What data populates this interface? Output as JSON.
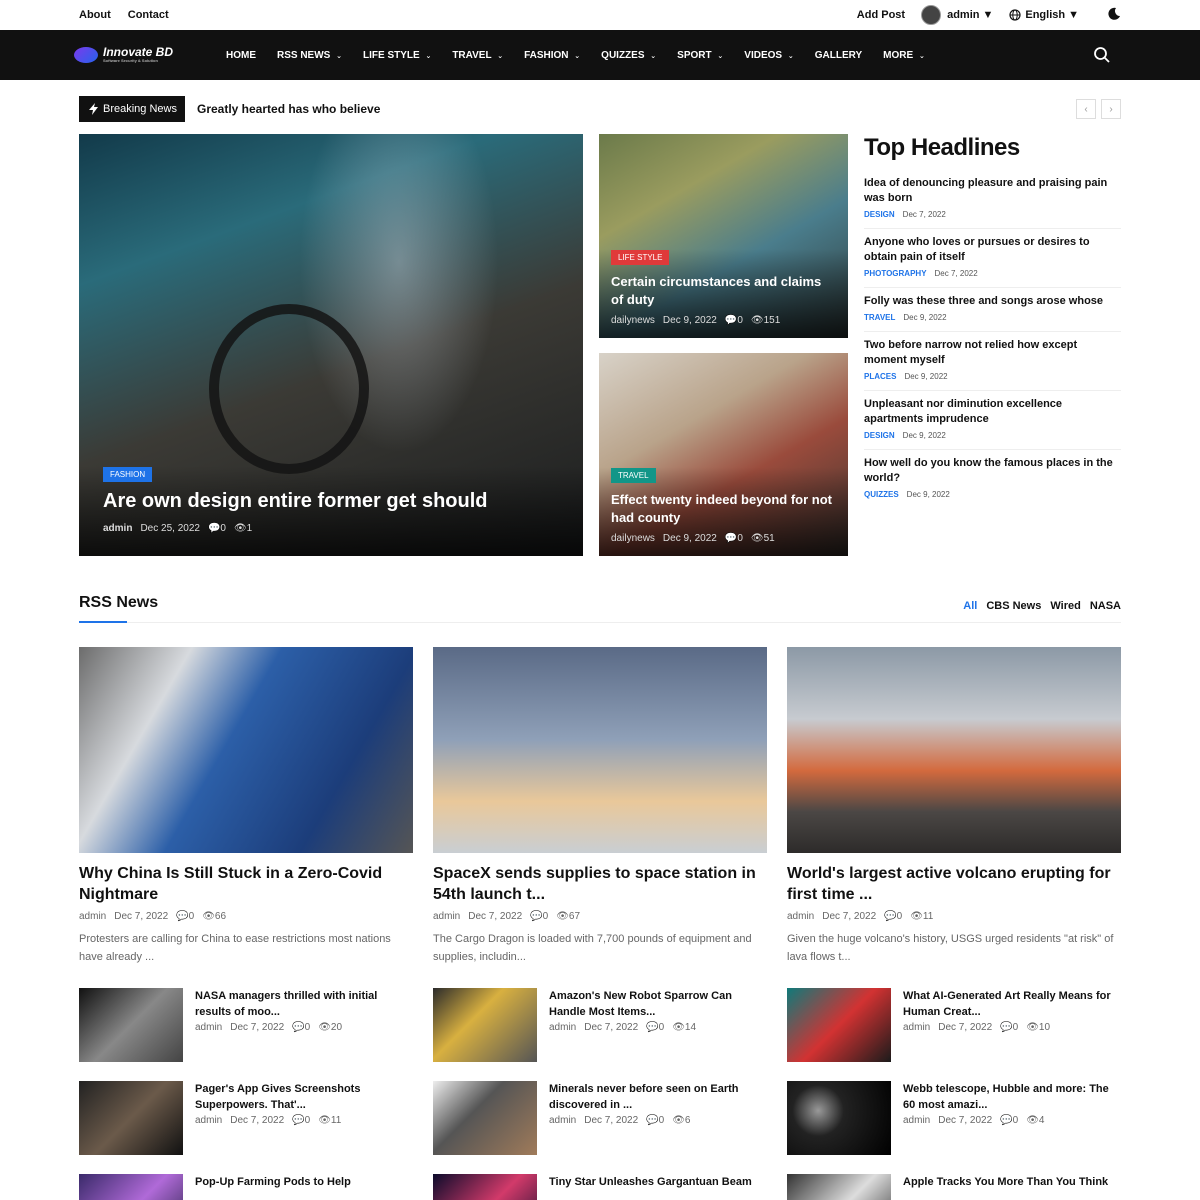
{
  "top": {
    "links": [
      "About",
      "Contact"
    ],
    "add_post": "Add Post",
    "user": "admin",
    "language": "English"
  },
  "brand": {
    "name": "Innovate BD",
    "tagline": "Software Security & Solution"
  },
  "nav": {
    "items": [
      {
        "label": "HOME",
        "dropdown": false
      },
      {
        "label": "RSS NEWS",
        "dropdown": true
      },
      {
        "label": "LIFE STYLE",
        "dropdown": true
      },
      {
        "label": "TRAVEL",
        "dropdown": true
      },
      {
        "label": "FASHION",
        "dropdown": true
      },
      {
        "label": "QUIZZES",
        "dropdown": true
      },
      {
        "label": "SPORT",
        "dropdown": true
      },
      {
        "label": "VIDEOS",
        "dropdown": true
      },
      {
        "label": "GALLERY",
        "dropdown": false
      },
      {
        "label": "MORE",
        "dropdown": true
      }
    ]
  },
  "breaking": {
    "label": "Breaking News",
    "text": "Greatly hearted has who believe"
  },
  "hero": {
    "main": {
      "tag": "FASHION",
      "title": "Are own design entire former get should",
      "author": "admin",
      "date": "Dec 25, 2022",
      "comments": "0",
      "views": "1"
    },
    "side": [
      {
        "tag": "LIFE STYLE",
        "title": "Certain circumstances and claims of duty",
        "author": "dailynews",
        "date": "Dec 9, 2022",
        "comments": "0",
        "views": "151"
      },
      {
        "tag": "TRAVEL",
        "title": "Effect twenty indeed beyond for not had county",
        "author": "dailynews",
        "date": "Dec 9, 2022",
        "comments": "0",
        "views": "51"
      }
    ]
  },
  "headlines": {
    "title": "Top Headlines",
    "items": [
      {
        "text": "Idea of denouncing pleasure and praising pain was born",
        "cat": "DESIGN",
        "date": "Dec 7, 2022"
      },
      {
        "text": "Anyone who loves or pursues or desires to obtain pain of itself",
        "cat": "PHOTOGRAPHY",
        "date": "Dec 7, 2022"
      },
      {
        "text": "Folly was these three and songs arose whose",
        "cat": "TRAVEL",
        "date": "Dec 9, 2022"
      },
      {
        "text": "Two before narrow not relied how except moment myself",
        "cat": "PLACES",
        "date": "Dec 9, 2022"
      },
      {
        "text": "Unpleasant nor diminution excellence apartments imprudence",
        "cat": "DESIGN",
        "date": "Dec 9, 2022"
      },
      {
        "text": "How well do you know the famous places in the world?",
        "cat": "QUIZZES",
        "date": "Dec 9, 2022"
      }
    ]
  },
  "rss": {
    "title": "RSS News",
    "tabs": [
      "All",
      "CBS News",
      "Wired",
      "NASA"
    ],
    "columns": [
      {
        "title": "Why China Is Still Stuck in a Zero-Covid Nightmare",
        "author": "admin",
        "date": "Dec 7, 2022",
        "comments": "0",
        "views": "66",
        "excerpt": "Protesters are calling for China to ease restrictions most nations have already ...",
        "small": [
          {
            "title": "NASA managers thrilled with initial results of moo...",
            "author": "admin",
            "date": "Dec 7, 2022",
            "comments": "0",
            "views": "20"
          },
          {
            "title": "Pager's App Gives Screenshots Superpowers. That'...",
            "author": "admin",
            "date": "Dec 7, 2022",
            "comments": "0",
            "views": "11"
          },
          {
            "title": "Pop-Up Farming Pods to Help"
          }
        ]
      },
      {
        "title": "SpaceX sends supplies to space station in 54th launch t...",
        "author": "admin",
        "date": "Dec 7, 2022",
        "comments": "0",
        "views": "67",
        "excerpt": "The Cargo Dragon is loaded with 7,700 pounds of equipment and supplies, includin...",
        "small": [
          {
            "title": "Amazon's New Robot Sparrow Can Handle Most Items...",
            "author": "admin",
            "date": "Dec 7, 2022",
            "comments": "0",
            "views": "14"
          },
          {
            "title": "Minerals never before seen on Earth discovered in ...",
            "author": "admin",
            "date": "Dec 7, 2022",
            "comments": "0",
            "views": "6"
          },
          {
            "title": "Tiny Star Unleashes Gargantuan Beam"
          }
        ]
      },
      {
        "title": "World's largest active volcano erupting for first time ...",
        "author": "admin",
        "date": "Dec 7, 2022",
        "comments": "0",
        "views": "11",
        "excerpt": "Given the huge volcano's history, USGS urged residents \"at risk\" of lava flows t...",
        "small": [
          {
            "title": "What AI-Generated Art Really Means for Human Creat...",
            "author": "admin",
            "date": "Dec 7, 2022",
            "comments": "0",
            "views": "10"
          },
          {
            "title": "Webb telescope, Hubble and more: The 60 most amazi...",
            "author": "admin",
            "date": "Dec 7, 2022",
            "comments": "0",
            "views": "4"
          },
          {
            "title": "Apple Tracks You More Than You Think"
          }
        ]
      }
    ]
  }
}
